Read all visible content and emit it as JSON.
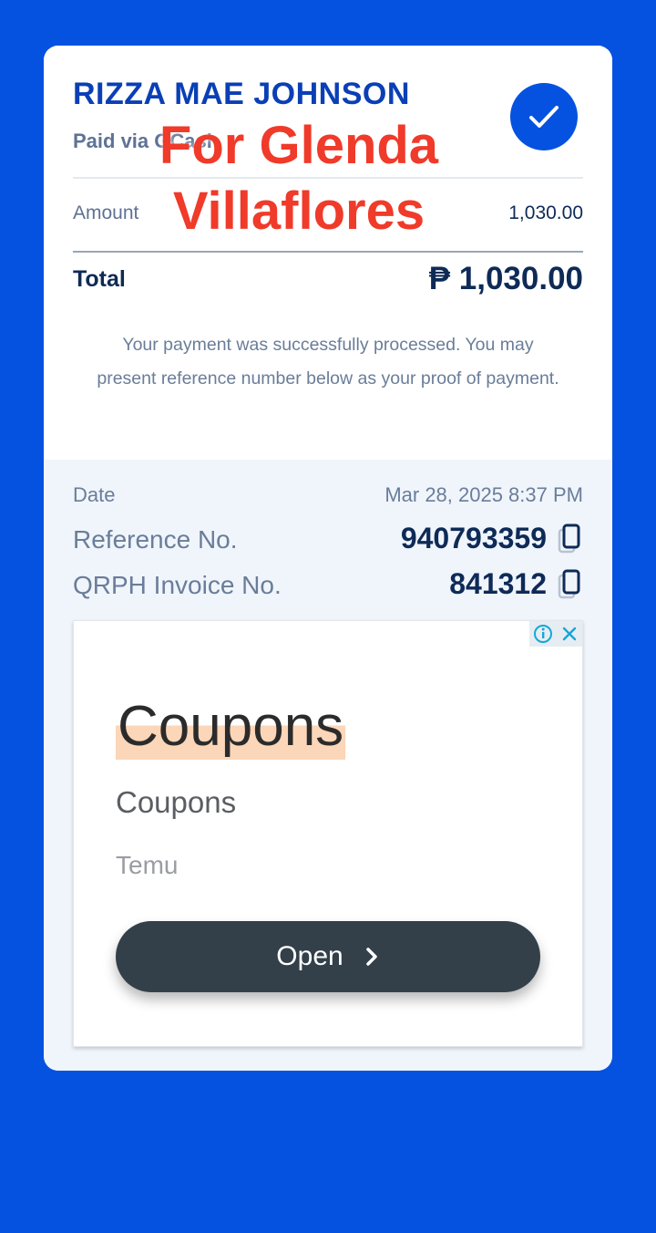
{
  "receipt": {
    "payee_name": "RIZZA MAE JOHNSON",
    "paid_via": "Paid via GCash",
    "amount_label": "Amount",
    "amount_value": "1,030.00",
    "total_label": "Total",
    "total_value": "₱ 1,030.00",
    "success_message": "Your payment was successfully processed. You may present reference number below as your proof of payment.",
    "status_icon": "check-icon"
  },
  "watermark": {
    "line1": "For Glenda",
    "line2": "Villaflores"
  },
  "details": {
    "date_label": "Date",
    "date_value": "Mar 28, 2025 8:37 PM",
    "reference_label": "Reference No.",
    "reference_value": "940793359",
    "invoice_label": "QRPH Invoice No.",
    "invoice_value": "841312"
  },
  "ad": {
    "title": "Coupons",
    "subtitle": "Coupons",
    "advertiser": "Temu",
    "button_label": "Open",
    "choices_icons": [
      "info-icon",
      "close-icon"
    ]
  },
  "colors": {
    "background": "#0552e0",
    "card": "#ffffff",
    "details_bg": "#f0f5fc",
    "brand_blue": "#0a3fb5",
    "navy_text": "#0e2a57",
    "watermark_red": "#f03a2a"
  }
}
